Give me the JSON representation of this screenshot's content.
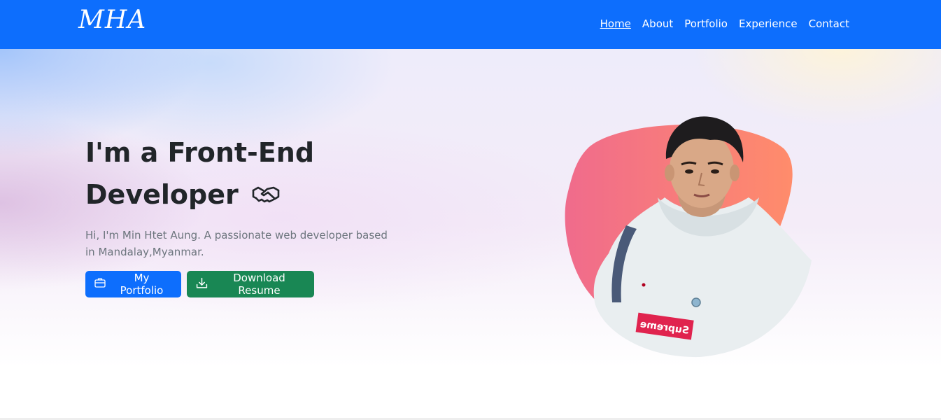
{
  "brand": {
    "text": "MHA"
  },
  "nav": {
    "items": [
      {
        "label": "Home",
        "active": true
      },
      {
        "label": "About"
      },
      {
        "label": "Portfolio"
      },
      {
        "label": "Experience"
      },
      {
        "label": "Contact"
      }
    ]
  },
  "hero": {
    "title_line1": "I'm a Front-End",
    "title_line2": "Developer",
    "title_icon": "handshake-icon",
    "description": "Hi, I'm Min Htet Aung. A passionate web developer based in Mandalay,Myanmar.",
    "buttons": {
      "portfolio": {
        "label": "My Portfolio",
        "icon": "briefcase-icon"
      },
      "resume": {
        "label": "Download Resume",
        "icon": "download-icon"
      }
    },
    "photo": {
      "shirt_text": "Supreme"
    }
  },
  "colors": {
    "navbar": "#0d6efd",
    "primary": "#0d6efd",
    "success": "#198754",
    "title_text": "#212529",
    "muted_text": "#6c757d",
    "blob_start": "#f06b8c",
    "blob_end": "#ff8c6b"
  }
}
